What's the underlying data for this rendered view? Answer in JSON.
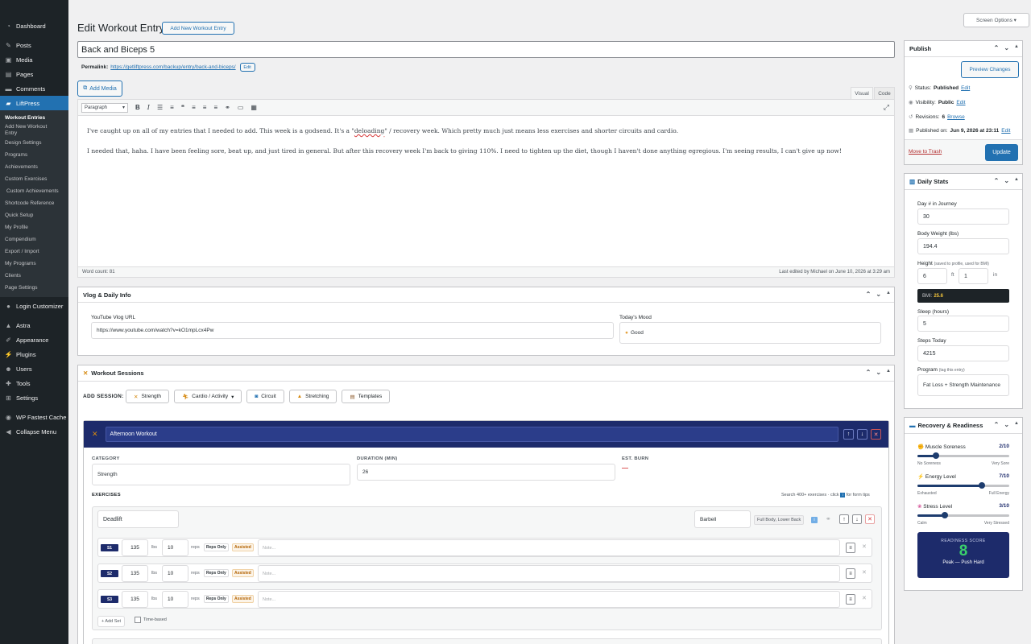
{
  "menu": {
    "top": [
      {
        "label": "Dashboard",
        "icon": "dashboard-icon"
      }
    ],
    "items": [
      {
        "label": "Posts",
        "icon": "pin-icon"
      },
      {
        "label": "Media",
        "icon": "media-icon"
      },
      {
        "label": "Pages",
        "icon": "pages-icon"
      },
      {
        "label": "Comments",
        "icon": "comments-icon"
      }
    ],
    "current": {
      "label": "LiftPress",
      "icon": "liftpress-icon"
    },
    "submenu": [
      "Workout Entries",
      "Add New Workout Entry",
      "Design Settings",
      "Programs",
      "Achievements",
      "Custom Exercises",
      "Custom Achievements",
      "Shortcode Reference",
      "Quick Setup",
      "My Profile",
      "Compendium",
      "Export / Import",
      "My Programs",
      "Clients",
      "Page Settings"
    ],
    "after": [
      {
        "label": "Login Customizer",
        "icon": "login-icon"
      }
    ],
    "after2": [
      {
        "label": "Astra",
        "icon": "astra-icon"
      },
      {
        "label": "Appearance",
        "icon": "brush-icon"
      },
      {
        "label": "Plugins",
        "icon": "plugin-icon"
      },
      {
        "label": "Users",
        "icon": "users-icon"
      },
      {
        "label": "Tools",
        "icon": "tools-icon"
      },
      {
        "label": "Settings",
        "icon": "settings-icon"
      }
    ],
    "after3": [
      {
        "label": "WP Fastest Cache",
        "icon": "cache-icon"
      },
      {
        "label": "Collapse Menu",
        "icon": "collapse-icon"
      }
    ]
  },
  "screen_options": "Screen Options",
  "page": {
    "title": "Edit Workout Entry",
    "add_new": "Add New Workout Entry",
    "post_title": "Back and Biceps 5",
    "permalink_label": "Permalink:",
    "permalink_base": "https://getliftpress.com/backup/entry/",
    "permalink_slug": "back-and-biceps/",
    "edit": "Edit"
  },
  "editor": {
    "add_media": "Add Media",
    "tab_visual": "Visual",
    "tab_code": "Code",
    "format": "Paragraph",
    "p1_before": "I've caught up on all of my entries that I needed to add. This week is a godsend. It's a \"",
    "p1_misspelled": "deloading",
    "p1_after": "\" / recovery week. Which pretty much just means less exercises and shorter circuits and cardio.",
    "p2": "I needed that, haha. I have been feeling sore, beat up, and just tired in general. But after this recovery week I'm back to giving 110%. I need to tighten up the diet, though I haven't done anything egregious. I'm seeing results, I can't give up now!",
    "word_count": "Word count: 81",
    "last_edited": "Last edited by Michael on June 10, 2026 at 3:29 am"
  },
  "vlog": {
    "title": "Vlog & Daily Info",
    "url_label": "YouTube Vlog URL",
    "url_value": "https://www.youtube.com/watch?v=kO1mpLcx4Pw",
    "mood_label": "Today's Mood",
    "mood_value": "Good"
  },
  "sessions": {
    "title": "Workout Sessions",
    "add_label": "ADD SESSION:",
    "buttons": [
      "Strength",
      "Cardio / Activity",
      "Circuit",
      "Stretching",
      "Templates"
    ],
    "card_title": "Afternoon Workout",
    "category_label": "CATEGORY",
    "category_value": "Strength",
    "duration_label": "DURATION (MIN)",
    "duration_value": "26",
    "burn_label": "EST. BURN",
    "burn_value": "—",
    "exercises_label": "EXERCISES",
    "search_hint_before": "Search 400+ exercises · click",
    "search_hint_after": "for form tips",
    "exercise_name": "Deadlift",
    "equipment": "Barbell",
    "muscles": "Full Body, Lower Back",
    "sets": [
      {
        "label": "S1",
        "weight": "135",
        "unit": "lbs",
        "reps": "10",
        "reps_unit": "reps"
      },
      {
        "label": "S2",
        "weight": "135",
        "unit": "lbs",
        "reps": "10",
        "reps_unit": "reps"
      },
      {
        "label": "S3",
        "weight": "135",
        "unit": "lbs",
        "reps": "10",
        "reps_unit": "reps"
      }
    ],
    "reps_only": "Reps Only",
    "assisted": "Assisted",
    "note_placeholder": "Note...",
    "add_set": "+ Add Set",
    "time_based": "Time-based"
  },
  "publish": {
    "title": "Publish",
    "preview": "Preview Changes",
    "status_label": "Status:",
    "status_value": "Published",
    "visibility_label": "Visibility:",
    "visibility_value": "Public",
    "revisions_label": "Revisions:",
    "revisions_value": "6",
    "browse": "Browse",
    "published_on_label": "Published on:",
    "published_on_value": "Jun 9, 2026 at 23:11",
    "edit": "Edit",
    "trash": "Move to Trash",
    "update": "Update"
  },
  "daily": {
    "title": "Daily Stats",
    "day_label": "Day # in Journey",
    "day_value": "30",
    "weight_label": "Body Weight (lbs)",
    "weight_value": "194.4",
    "height_label": "Height",
    "height_note": "(saved to profile, used for BMI)",
    "height_ft": "6",
    "ft": "ft",
    "height_in": "1",
    "in": "in",
    "bmi_label": "BMI:",
    "bmi_value": "25.6",
    "sleep_label": "Sleep (hours)",
    "sleep_value": "5",
    "steps_label": "Steps Today",
    "steps_value": "4215",
    "program_label": "Program",
    "program_note": "(tag this entry)",
    "program_value": "Fat Loss + Strength Maintenance"
  },
  "recovery": {
    "title": "Recovery & Readiness",
    "items": [
      {
        "label": "Muscle Soreness",
        "score": "2/10",
        "value": 2,
        "min": "No Soreness",
        "max": "Very Sore",
        "icon": "muscle-icon"
      },
      {
        "label": "Energy Level",
        "score": "7/10",
        "value": 7,
        "min": "Exhausted",
        "max": "Full Energy",
        "icon": "lightning-icon"
      },
      {
        "label": "Stress Level",
        "score": "3/10",
        "value": 3,
        "min": "Calm",
        "max": "Very Stressed",
        "icon": "brain-icon"
      }
    ],
    "readiness_label": "READINESS SCORE",
    "readiness_value": "8",
    "readiness_text": "Peak — Push Hard"
  },
  "colors": {
    "accent": "#2271b1",
    "navy": "#1d2b6b",
    "menu_bg": "#1d2327",
    "score_green": "#3ad06b"
  }
}
